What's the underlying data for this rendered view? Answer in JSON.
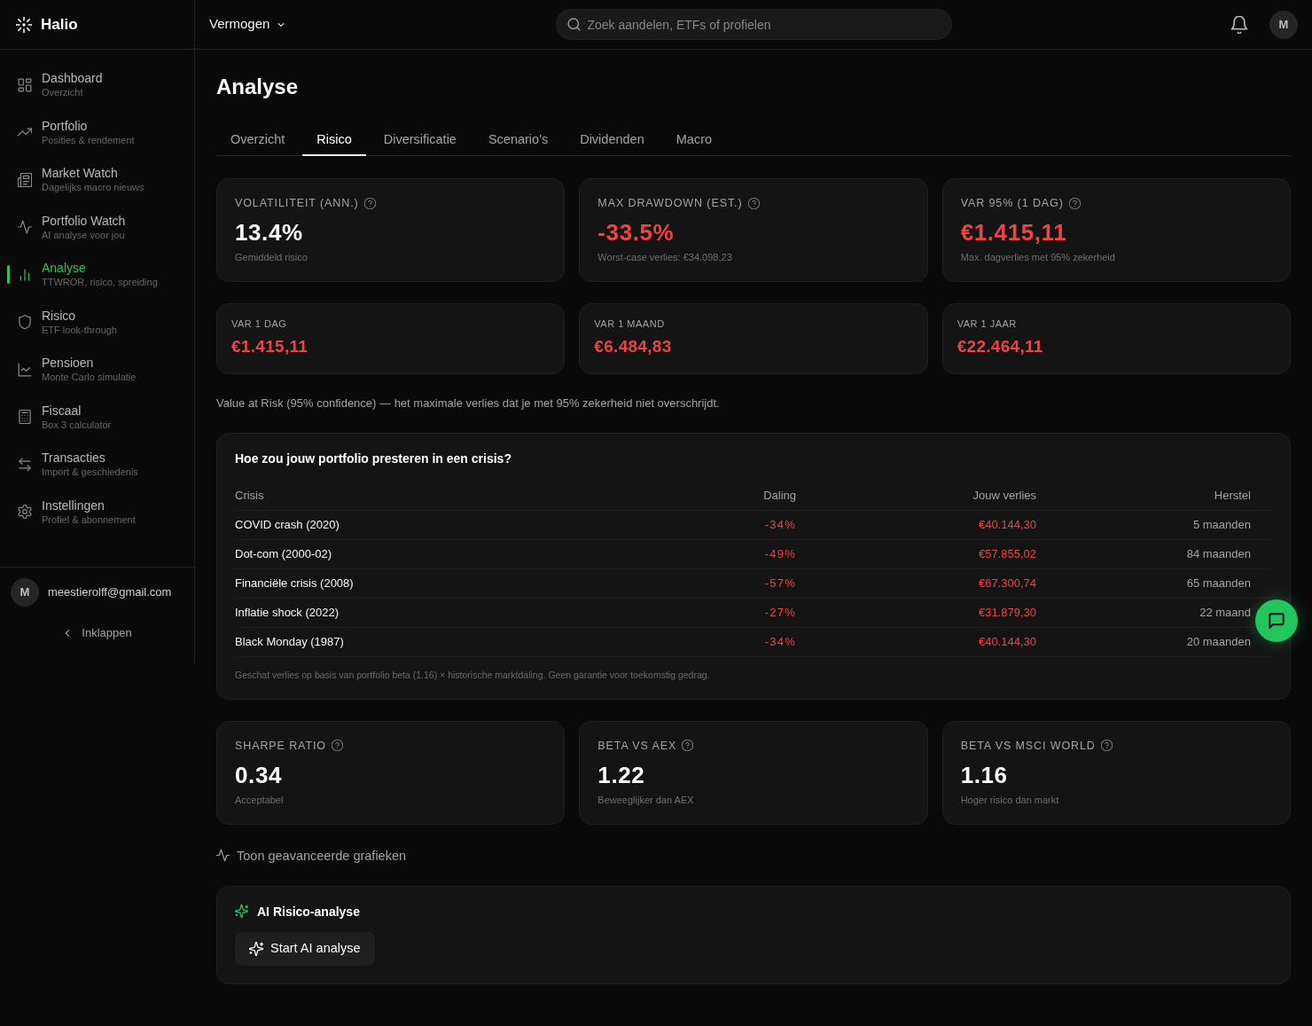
{
  "brand": {
    "name": "Halio"
  },
  "sidebar": {
    "items": [
      {
        "label": "Dashboard",
        "subtitle": "Overzicht",
        "selected": false
      },
      {
        "label": "Portfolio",
        "subtitle": "Posities & rendement",
        "selected": false
      },
      {
        "label": "Market Watch",
        "subtitle": "Dagelijks macro nieuws",
        "selected": false
      },
      {
        "label": "Portfolio Watch",
        "subtitle": "AI analyse voor jou",
        "selected": false
      },
      {
        "label": "Analyse",
        "subtitle": "TTWROR, risico, spreiding",
        "selected": true
      },
      {
        "label": "Risico",
        "subtitle": "ETF look-through",
        "selected": false
      },
      {
        "label": "Pensioen",
        "subtitle": "Monte Carlo simulatie",
        "selected": false
      },
      {
        "label": "Fiscaal",
        "subtitle": "Box 3 calculator",
        "selected": false
      },
      {
        "label": "Transacties",
        "subtitle": "Import & geschiedenis",
        "selected": false
      },
      {
        "label": "Instellingen",
        "subtitle": "Profiel & abonnement",
        "selected": false
      }
    ],
    "user": {
      "initial": "M",
      "email": "meestierolff@gmail.com"
    },
    "collapse_label": "Inklappen"
  },
  "topbar": {
    "workspace": "Vermogen",
    "search": {
      "placeholder": "Zoek aandelen, ETFs of profielen"
    },
    "avatar": "M"
  },
  "page_title": "Analyse",
  "tabs": [
    {
      "label": "Overzicht",
      "selected": false
    },
    {
      "label": "Risico",
      "selected": true
    },
    {
      "label": "Diversificatie",
      "selected": false
    },
    {
      "label": "Scenario's",
      "selected": false
    },
    {
      "label": "Dividenden",
      "selected": false
    },
    {
      "label": "Macro",
      "selected": false
    }
  ],
  "risk_metrics": [
    {
      "label": "VOLATILITEIT (ANN.)",
      "value": "13.4%",
      "note": "Gemiddeld risico",
      "negative": false
    },
    {
      "label": "MAX DRAWDOWN (EST.)",
      "value": "-33.5%",
      "note": "Worst-case verlies: €34.098,23",
      "negative": true
    },
    {
      "label": "VAR 95% (1 DAG)",
      "value": "€1.415,11",
      "note": "Max. dagverlies met 95% zekerheid",
      "negative": true
    }
  ],
  "var_horizons": [
    {
      "label": "VAR 1 DAG",
      "value": "€1.415,11",
      "negative": true
    },
    {
      "label": "VAR 1 MAAND",
      "value": "€6.484,83",
      "negative": true
    },
    {
      "label": "VAR 1 JAAR",
      "value": "€22.464,11",
      "negative": true
    }
  ],
  "var_note": "Value at Risk (95% confidence) — het maximale verlies dat je met 95% zekerheid niet overschrijdt.",
  "crisis": {
    "title": "Hoe zou jouw portfolio presteren in een crisis?",
    "columns": [
      "Crisis",
      "Daling",
      "Jouw verlies",
      "Herstel"
    ],
    "rows": [
      {
        "crisis": "COVID crash (2020)",
        "drop": "-34%",
        "loss": "€40.144,30",
        "recovery": "5 maanden"
      },
      {
        "crisis": "Dot-com (2000-02)",
        "drop": "-49%",
        "loss": "€57.855,02",
        "recovery": "84 maanden"
      },
      {
        "crisis": "Financiële crisis (2008)",
        "drop": "-57%",
        "loss": "€67.300,74",
        "recovery": "65 maanden"
      },
      {
        "crisis": "Inflatie shock (2022)",
        "drop": "-27%",
        "loss": "€31.879,30",
        "recovery": "22 maand"
      },
      {
        "crisis": "Black Monday (1987)",
        "drop": "-34%",
        "loss": "€40.144,30",
        "recovery": "20 maanden"
      }
    ],
    "footnote": "Geschat verlies op basis van portfolio beta (1.16) × historische marktdaling. Geen garantie voor toekomstig gedrag."
  },
  "ratio_metrics": [
    {
      "label": "SHARPE RATIO",
      "value": "0.34",
      "note": "Acceptabel",
      "negative": false
    },
    {
      "label": "BETA VS AEX",
      "value": "1.22",
      "note": "Beweeglijker dan AEX",
      "negative": false
    },
    {
      "label": "BETA VS MSCI WORLD",
      "value": "1.16",
      "note": "Hoger risico dan markt",
      "negative": false
    }
  ],
  "advanced_toggle": {
    "label": "Toon geavanceerde grafieken"
  },
  "ai_panel": {
    "title": "AI Risico-analyse",
    "button": "Start AI analyse"
  }
}
